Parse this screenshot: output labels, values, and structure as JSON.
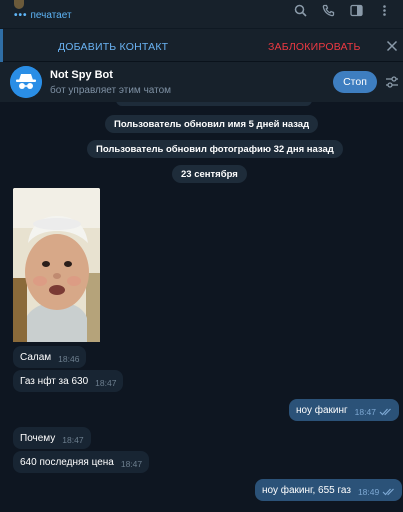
{
  "header": {
    "typing_status": "печатает",
    "typing_dots": "•••",
    "icons": [
      "search-icon",
      "phone-icon",
      "sidebar-icon",
      "more-icon"
    ]
  },
  "action_bar": {
    "add_contact": "ДОБАВИТЬ КОНТАКТ",
    "block": "ЗАБЛОКИРОВАТЬ",
    "close_icon": "close-icon"
  },
  "bot_bar": {
    "name": "Not Spy Bot",
    "subtitle": "бот управляет этим чатом",
    "stop_label": "Стоп",
    "settings_icon": "settings-icon"
  },
  "service_messages": [
    "Пользователь обновил имя 5 дней назад",
    "Пользователь обновил фотографию 32 дня назад",
    "23 сентября"
  ],
  "messages": [
    {
      "direction": "in",
      "text": "Салам",
      "time": "18:46"
    },
    {
      "direction": "in",
      "text": "Газ нфт за 630",
      "time": "18:47"
    },
    {
      "direction": "out",
      "text": "ноу факинг",
      "time": "18:47",
      "read": true
    },
    {
      "direction": "in",
      "text": "Почему",
      "time": "18:47"
    },
    {
      "direction": "in",
      "text": "640 последняя цена",
      "time": "18:47"
    },
    {
      "direction": "out",
      "text": "ноу факинг, 655 газ",
      "time": "18:49",
      "read": true
    }
  ],
  "colors": {
    "background": "#0e1621",
    "panel": "#17212b",
    "incoming_bubble": "#182533",
    "outgoing_bubble": "#2b5278",
    "accent_blue": "#6ab3f3",
    "danger_red": "#ec3942"
  }
}
